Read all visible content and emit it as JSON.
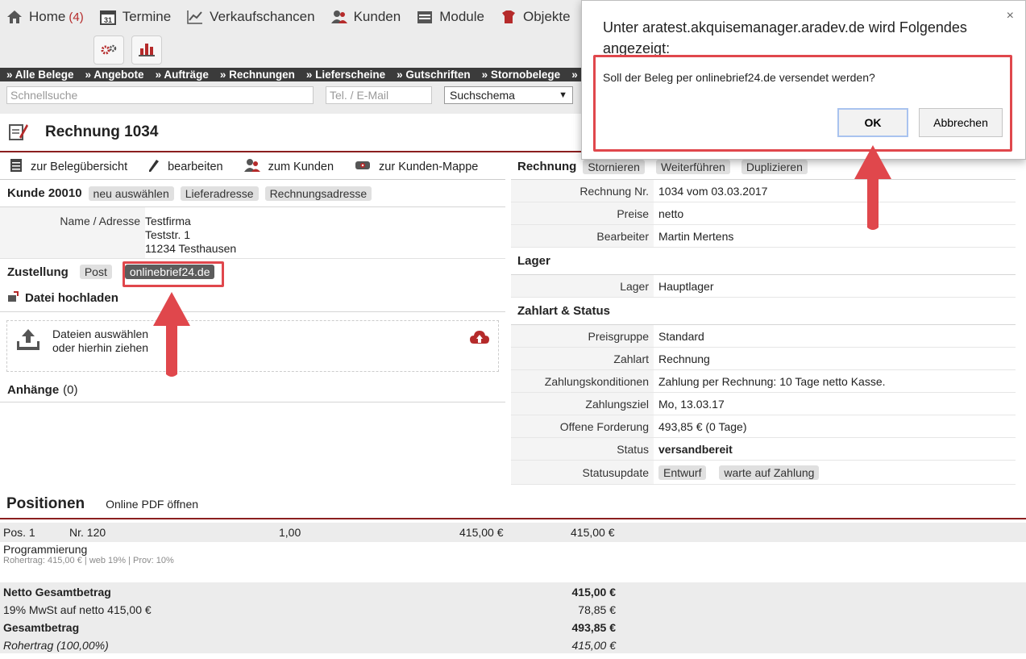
{
  "nav": {
    "items": [
      {
        "label": "Home",
        "count": "(4)",
        "icon": "home-icon"
      },
      {
        "label": "Termine",
        "icon": "calendar-icon"
      },
      {
        "label": "Verkaufschancen",
        "icon": "chart-line-icon"
      },
      {
        "label": "Kunden",
        "icon": "users-icon"
      },
      {
        "label": "Module",
        "icon": "module-icon"
      },
      {
        "label": "Objekte",
        "icon": "objects-icon"
      }
    ],
    "calendar_day": "31"
  },
  "belege_tabs": [
    "» Alle Belege",
    "» Angebote",
    "» Aufträge",
    "» Rechnungen",
    "» Lieferscheine",
    "» Gutschriften",
    "» Stornobelege",
    "»"
  ],
  "search": {
    "quick_placeholder": "Schnellsuche",
    "phone_placeholder": "Tel. / E-Mail",
    "schema_label": "Suchschema",
    "schema_arrow": "▼"
  },
  "page_title": "Rechnung 1034",
  "actions": [
    {
      "label": "zur Belegübersicht",
      "icon": "document-icon"
    },
    {
      "label": "bearbeiten",
      "icon": "pencil-icon"
    },
    {
      "label": "zum Kunden",
      "icon": "user-icon"
    },
    {
      "label": "zur Kunden-Mappe",
      "icon": "folder-icon"
    }
  ],
  "kunde": {
    "heading": "Kunde 20010",
    "chips": [
      "neu auswählen",
      "Lieferadresse",
      "Rechnungsadresse"
    ],
    "name_label": "Name / Adresse",
    "address": [
      "Testfirma",
      "Teststr. 1",
      "11234 Testhausen"
    ]
  },
  "zustellung": {
    "heading": "Zustellung",
    "post": "Post",
    "online": "onlinebrief24.de"
  },
  "upload": {
    "heading": "Datei hochladen",
    "line1": "Dateien auswählen",
    "line2": "oder hierhin ziehen"
  },
  "anhaenge": {
    "heading": "Anhänge",
    "count": "(0)"
  },
  "rechnung": {
    "heading": "Rechnung",
    "chips": [
      "Stornieren",
      "Weiterführen",
      "Duplizieren"
    ],
    "rows": [
      {
        "k": "Rechnung Nr.",
        "v": "1034 vom 03.03.2017"
      },
      {
        "k": "Preise",
        "v": "netto"
      },
      {
        "k": "Bearbeiter",
        "v": "Martin Mertens"
      }
    ]
  },
  "lager": {
    "heading": "Lager",
    "rows": [
      {
        "k": "Lager",
        "v": "Hauptlager"
      }
    ]
  },
  "zahlart": {
    "heading": "Zahlart & Status",
    "rows": [
      {
        "k": "Preisgruppe",
        "v": "Standard"
      },
      {
        "k": "Zahlart",
        "v": "Rechnung"
      },
      {
        "k": "Zahlungskonditionen",
        "v": "Zahlung per Rechnung: 10 Tage netto Kasse."
      },
      {
        "k": "Zahlungsziel",
        "v": "Mo, 13.03.17"
      },
      {
        "k": "Offene Forderung",
        "v": "493,85 € (0 Tage)"
      },
      {
        "k": "Status",
        "v": "versandbereit"
      }
    ],
    "statusupdate_label": "Statusupdate",
    "statusupdate_chips": [
      "Entwurf",
      "warte auf Zahlung"
    ]
  },
  "positionen": {
    "heading": "Positionen",
    "pdf_link": "Online PDF öffnen",
    "item": {
      "pos": "Pos. 1",
      "nr": "Nr. 120",
      "qty": "1,00",
      "price": "415,00 €",
      "total": "415,00 €",
      "name": "Programmierung",
      "meta": "Rohertrag: 415,00 € | web 19% | Prov: 10%"
    }
  },
  "totals": [
    {
      "label": "Netto Gesamtbetrag",
      "value": "415,00 €",
      "style": "bold"
    },
    {
      "label": "19% MwSt auf netto 415,00 €",
      "value": "78,85 €",
      "style": "normal"
    },
    {
      "label": "Gesamtbetrag",
      "value": "493,85 €",
      "style": "bold"
    },
    {
      "label": "Rohertrag (100,00%)",
      "value": "415,00 €",
      "style": "italic"
    }
  ],
  "dialog": {
    "title": "Unter aratest.akquisemanager.aradev.de wird Folgendes angezeigt:",
    "message": "Soll der Beleg per onlinebrief24.de versendet werden?",
    "ok": "OK",
    "cancel": "Abbrechen",
    "close": "×"
  },
  "colors": {
    "accent": "#8b1f1f",
    "annotation": "#e0474c"
  }
}
